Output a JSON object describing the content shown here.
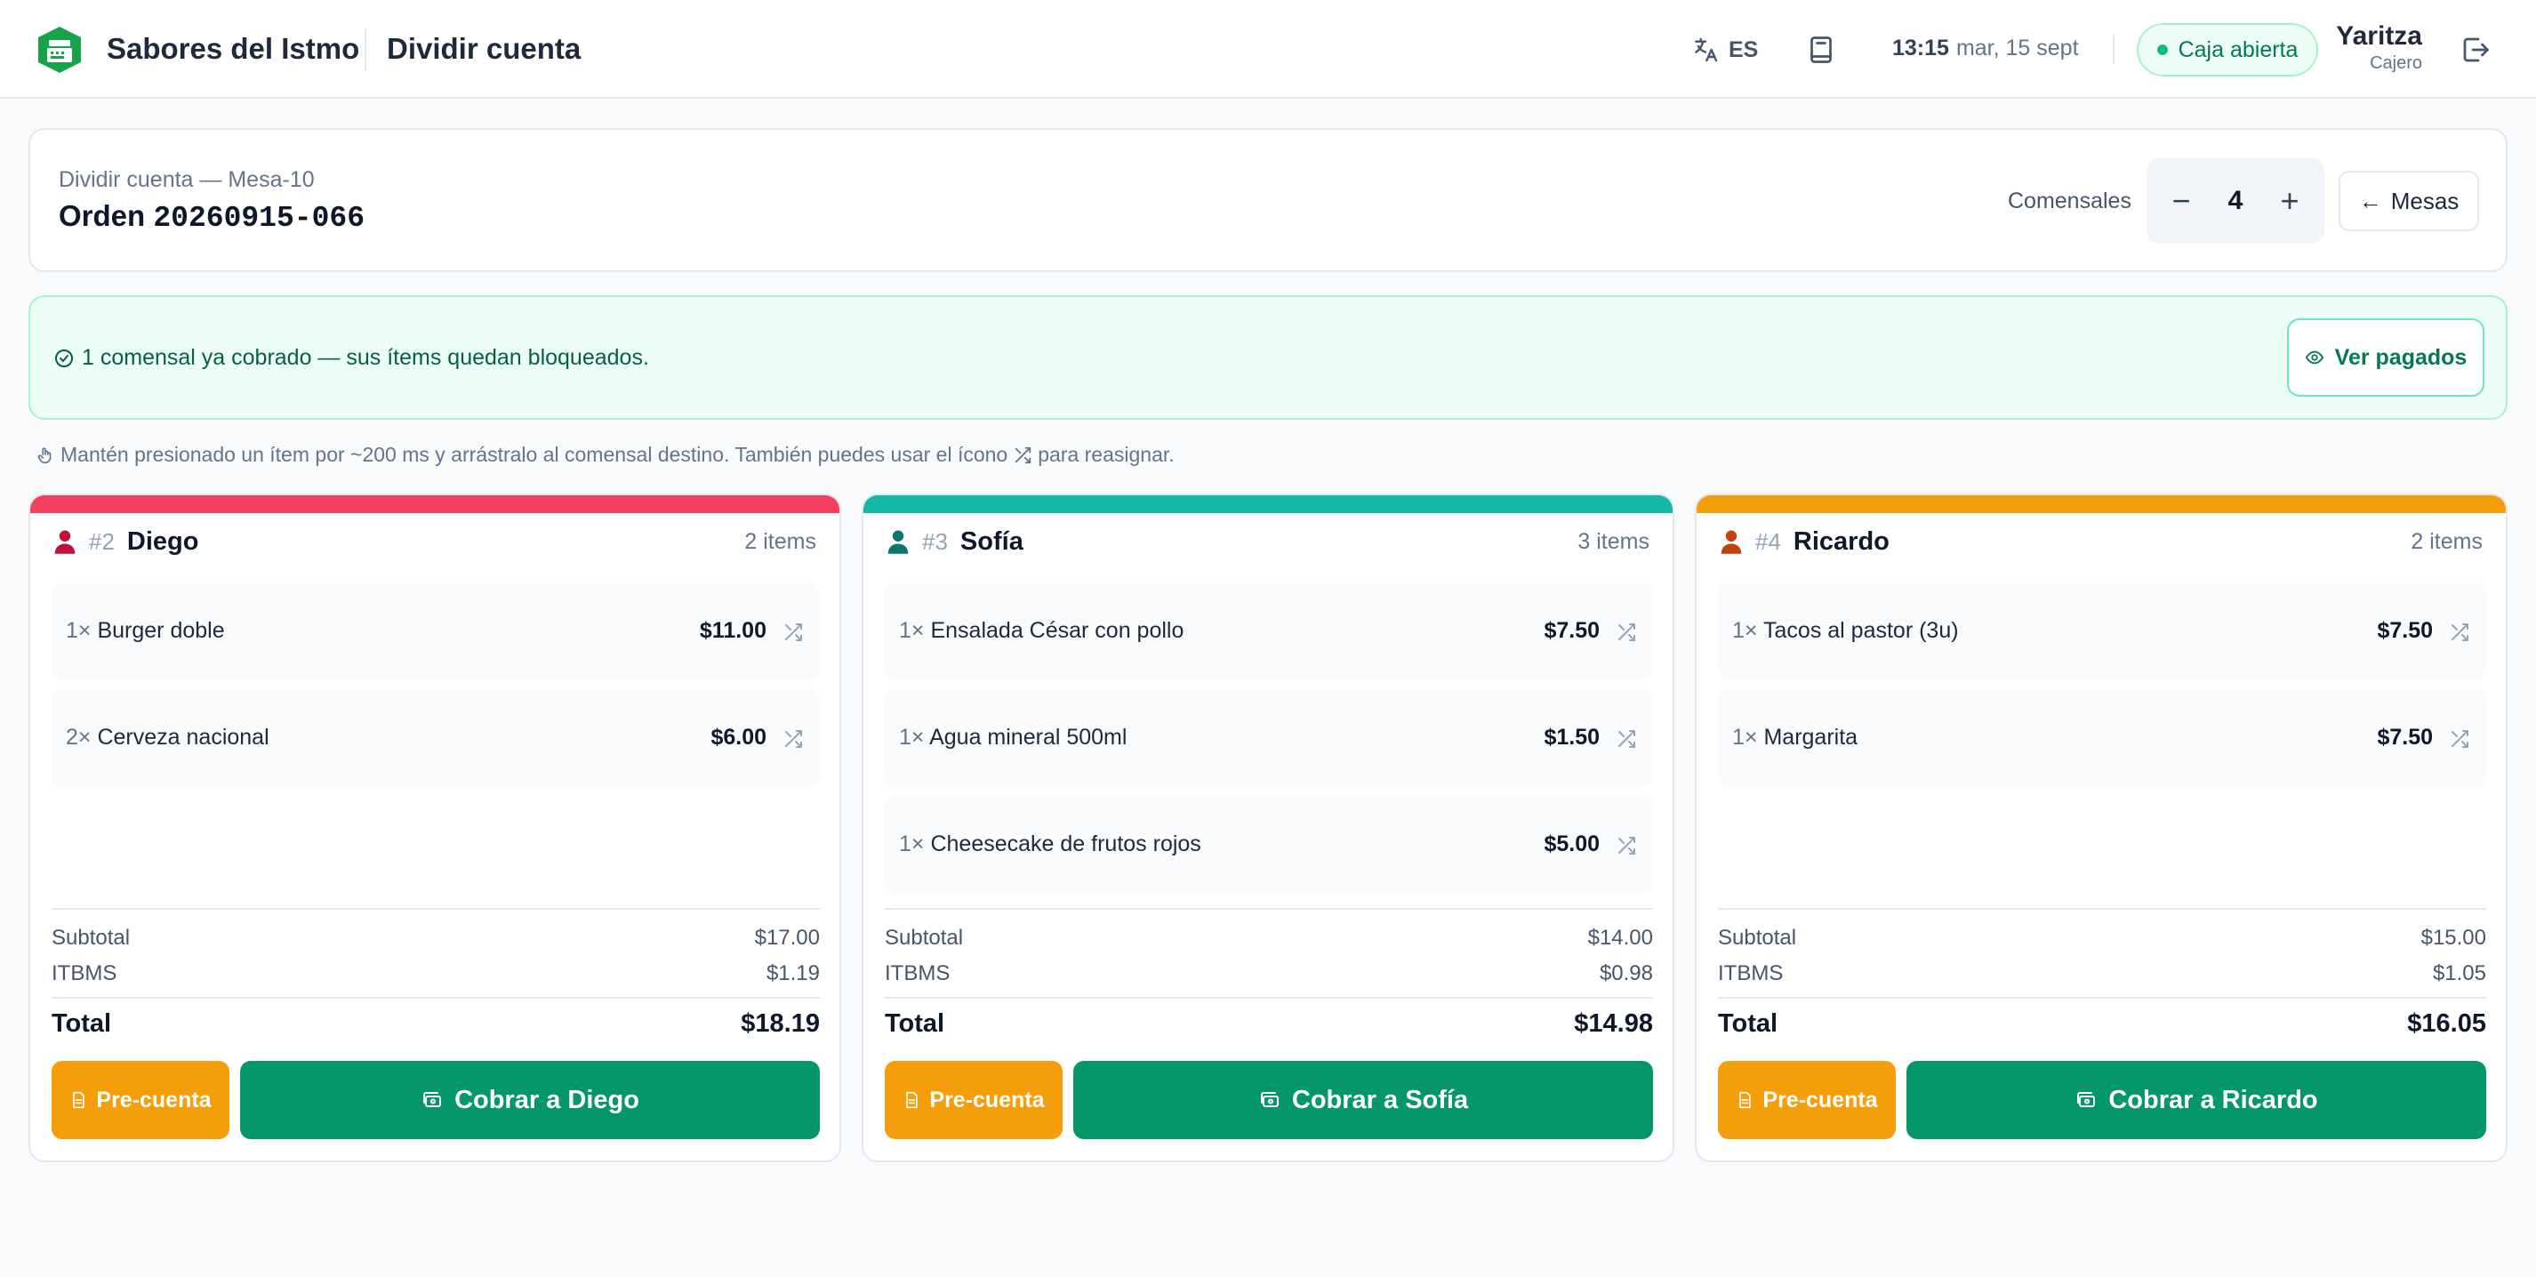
{
  "header": {
    "brand": "Sabores del Istmo",
    "title": "Dividir cuenta",
    "language": "ES",
    "time": "13:15",
    "date": "mar, 15 sept",
    "register_status": "Caja abierta",
    "user_name": "Yaritza",
    "user_role": "Cajero",
    "icons": [
      "cash-register-icon",
      "translate-icon",
      "book-icon",
      "logout-icon"
    ]
  },
  "order": {
    "subtitle": "Dividir cuenta — Mesa-10",
    "label": "Orden",
    "number": "20260915-066",
    "diners_label": "Comensales",
    "diners_count": "4",
    "decrement": "−",
    "increment": "+",
    "back_label": "Mesas",
    "back_arrow": "←"
  },
  "banner": {
    "message": "1 comensal ya cobrado — sus ítems quedan bloqueados.",
    "button": "Ver pagados"
  },
  "hint": {
    "text_before": "Mantén presionado un ítem por ~200 ms y arrástralo al comensal destino. También puedes usar el ícono",
    "text_after": "para reasignar."
  },
  "diners": [
    {
      "number": "#2",
      "name": "Diego",
      "count": "2 items",
      "accent": "#f43f5e",
      "icon_color": "#be123c",
      "items": [
        {
          "qty": "1×",
          "name": "Burger doble",
          "price": "$11.00"
        },
        {
          "qty": "2×",
          "name": "Cerveza nacional",
          "price": "$6.00"
        }
      ],
      "subtotal_label": "Subtotal",
      "subtotal": "$17.00",
      "tax_label": "ITBMS",
      "tax": "$1.19",
      "total_label": "Total",
      "total": "$18.19",
      "precuenta": "Pre-cuenta",
      "charge": "Cobrar a Diego"
    },
    {
      "number": "#3",
      "name": "Sofía",
      "count": "3 items",
      "accent": "#14b8a6",
      "icon_color": "#0f766e",
      "items": [
        {
          "qty": "1×",
          "name": "Ensalada César con pollo",
          "price": "$7.50"
        },
        {
          "qty": "1×",
          "name": "Agua mineral 500ml",
          "price": "$1.50"
        },
        {
          "qty": "1×",
          "name": "Cheesecake de frutos rojos",
          "price": "$5.00"
        }
      ],
      "subtotal_label": "Subtotal",
      "subtotal": "$14.00",
      "tax_label": "ITBMS",
      "tax": "$0.98",
      "total_label": "Total",
      "total": "$14.98",
      "precuenta": "Pre-cuenta",
      "charge": "Cobrar a Sofía"
    },
    {
      "number": "#4",
      "name": "Ricardo",
      "count": "2 items",
      "accent": "#f59e0b",
      "icon_color": "#c2410c",
      "items": [
        {
          "qty": "1×",
          "name": "Tacos al pastor (3u)",
          "price": "$7.50"
        },
        {
          "qty": "1×",
          "name": "Margarita",
          "price": "$7.50"
        }
      ],
      "subtotal_label": "Subtotal",
      "subtotal": "$15.00",
      "tax_label": "ITBMS",
      "tax": "$1.05",
      "total_label": "Total",
      "total": "$16.05",
      "precuenta": "Pre-cuenta",
      "charge": "Cobrar a Ricardo"
    }
  ],
  "colors": {
    "brand_green": "#16a34a",
    "charge_green": "#059669",
    "precuenta_orange": "#f59e0b",
    "banner_bg": "#ecfdf5"
  }
}
